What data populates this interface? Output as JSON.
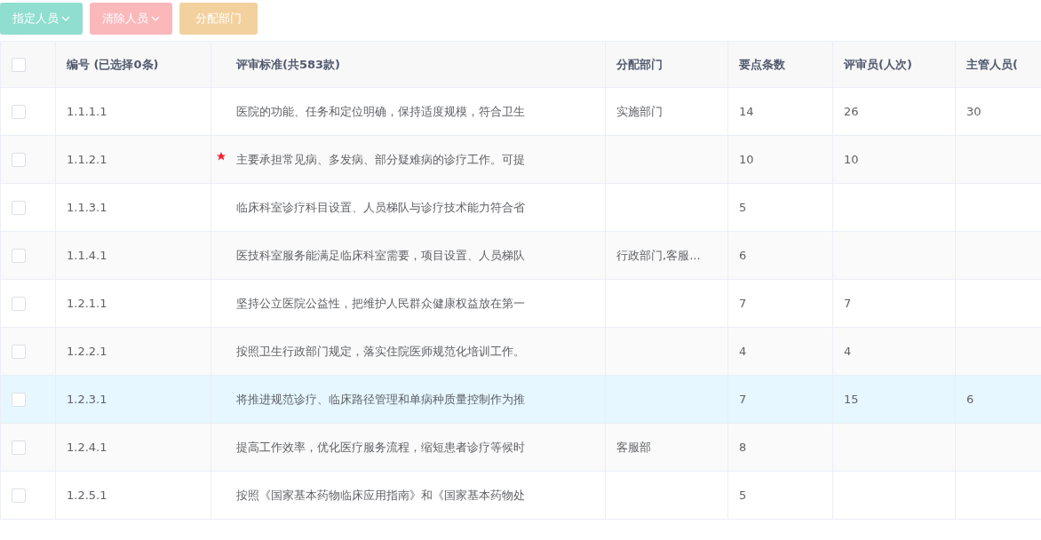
{
  "toolbar": {
    "buttons": [
      {
        "label": "指定人员",
        "kind": "assign",
        "dropdown": true
      },
      {
        "label": "清除人员",
        "kind": "clear",
        "dropdown": true
      },
      {
        "label": "分配部门",
        "kind": "dept",
        "dropdown": false
      }
    ]
  },
  "table": {
    "header_checked": false,
    "columns": [
      "编号 (已选择0条)",
      "评审标准(共583款)",
      "分配部门",
      "要点条数",
      "评审员(人次)",
      "主管人员("
    ],
    "rows": [
      {
        "checked": false,
        "selected": false,
        "starred": false,
        "cells": [
          "1.1.1.1",
          "医院的功能、任务和定位明确，保持适度规模，符合卫生",
          "实施部门",
          "14",
          "26",
          "30"
        ]
      },
      {
        "checked": false,
        "selected": false,
        "starred": true,
        "cells": [
          "1.1.2.1",
          "主要承担常见病、多发病、部分疑难病的诊疗工作。可提",
          "",
          "10",
          "10",
          ""
        ]
      },
      {
        "checked": false,
        "selected": false,
        "starred": false,
        "cells": [
          "1.1.3.1",
          "临床科室诊疗科目设置、人员梯队与诊疗技术能力符合省",
          "",
          "5",
          "",
          ""
        ]
      },
      {
        "checked": false,
        "selected": false,
        "starred": false,
        "cells": [
          "1.1.4.1",
          "医技科室服务能满足临床科室需要，项目设置、人员梯队",
          "行政部门,客服...",
          "6",
          "",
          ""
        ]
      },
      {
        "checked": false,
        "selected": false,
        "starred": false,
        "cells": [
          "1.2.1.1",
          "坚持公立医院公益性，把维护人民群众健康权益放在第一",
          "",
          "7",
          "7",
          ""
        ]
      },
      {
        "checked": false,
        "selected": false,
        "starred": false,
        "cells": [
          "1.2.2.1",
          "按照卫生行政部门规定，落实住院医师规范化培训工作。",
          "",
          "4",
          "4",
          ""
        ]
      },
      {
        "checked": false,
        "selected": true,
        "starred": false,
        "cells": [
          "1.2.3.1",
          "将推进规范诊疗、临床路径管理和单病种质量控制作为推",
          "",
          "7",
          "15",
          "6"
        ]
      },
      {
        "checked": false,
        "selected": false,
        "starred": false,
        "cells": [
          "1.2.4.1",
          "提高工作效率，优化医疗服务流程，缩短患者诊疗等候时",
          "客服部",
          "8",
          "",
          ""
        ]
      },
      {
        "checked": false,
        "selected": false,
        "starred": false,
        "cells": [
          "1.2.5.1",
          "按照《国家基本药物临床应用指南》和《国家基本药物处",
          "",
          "5",
          "",
          ""
        ]
      }
    ]
  }
}
